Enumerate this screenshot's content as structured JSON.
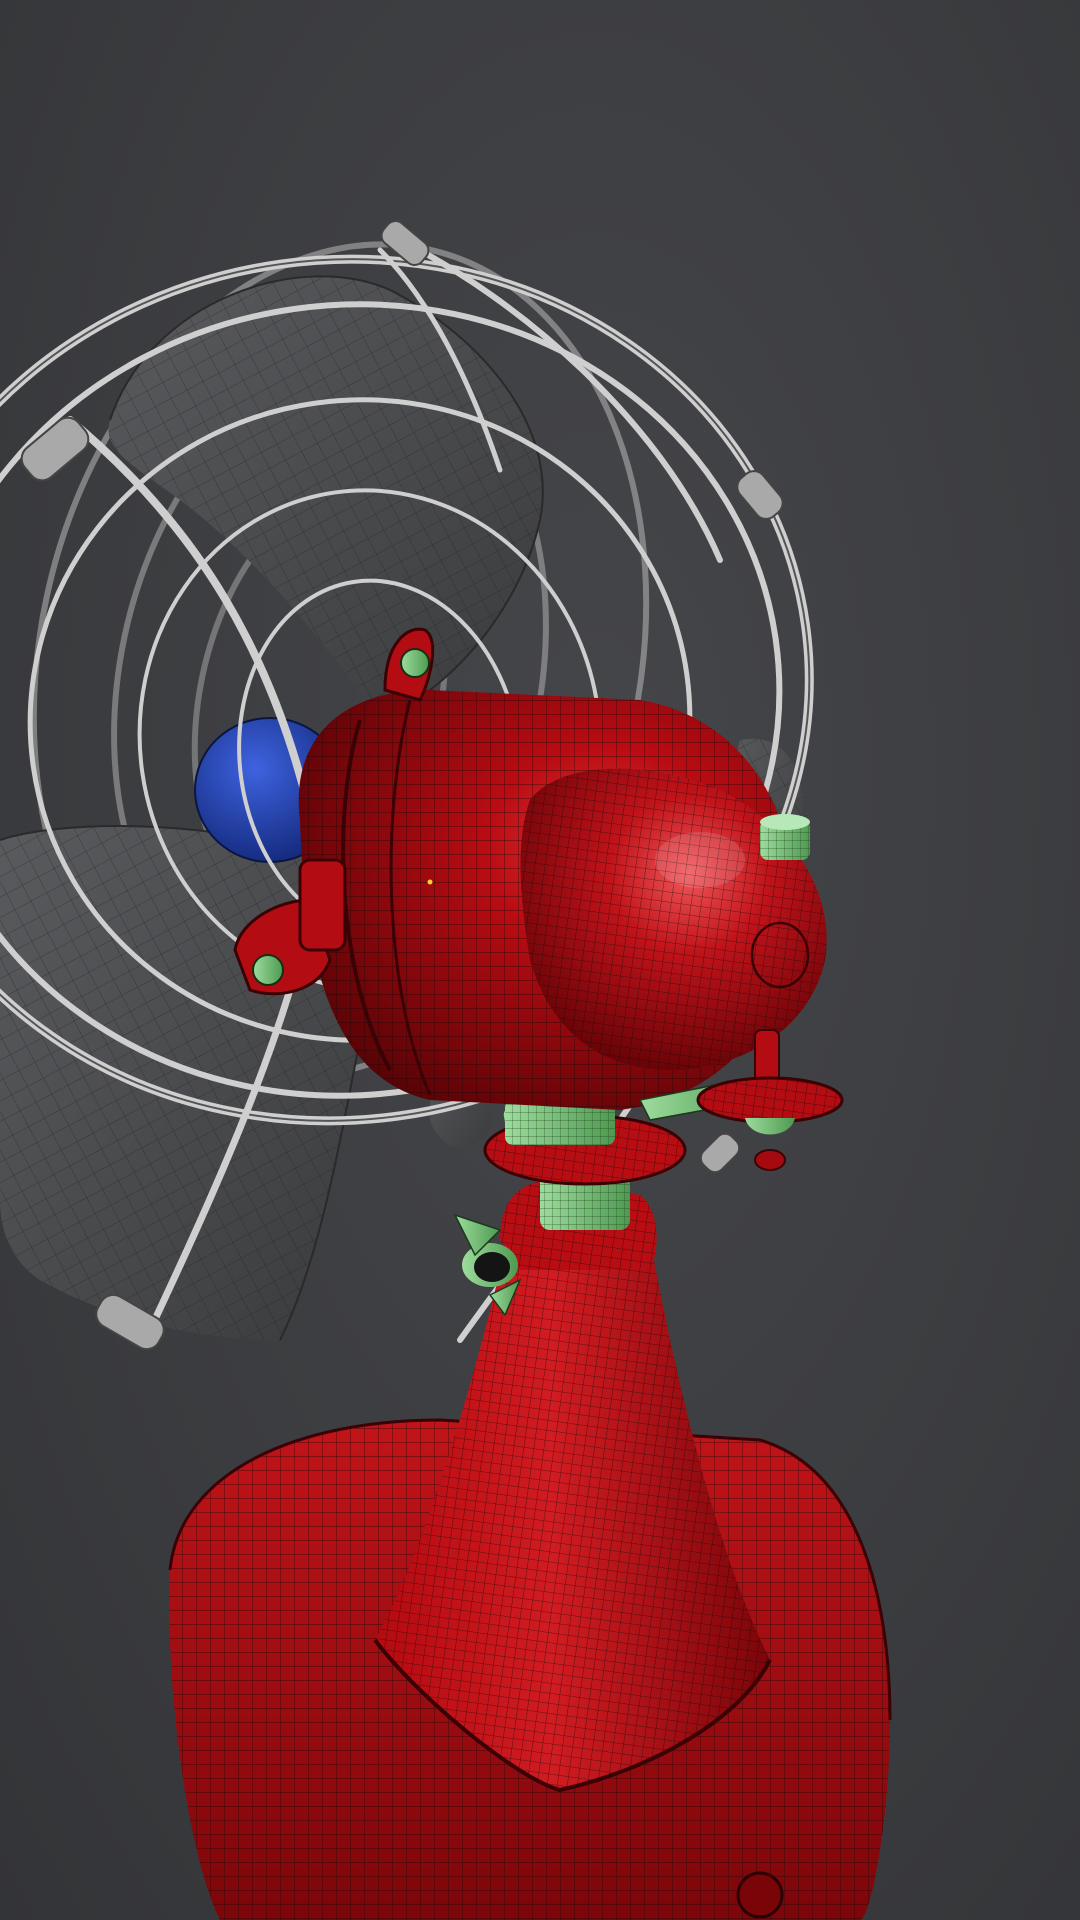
{
  "scene": {
    "subject": "vintage-desk-fan-wireframe-render",
    "colors": {
      "background": "#3b3c3e",
      "body_red": "#a8080c",
      "body_red_light": "#d42228",
      "body_red_dark": "#5e0407",
      "blade_gray": "#4a4b4d",
      "blade_gray_light": "#6a6b6d",
      "cage_wire": "#c9c9c9",
      "accent_green": "#7fc77f",
      "hub_blue": "#1f3fb0",
      "wire_line": "#1a0b0b"
    }
  }
}
